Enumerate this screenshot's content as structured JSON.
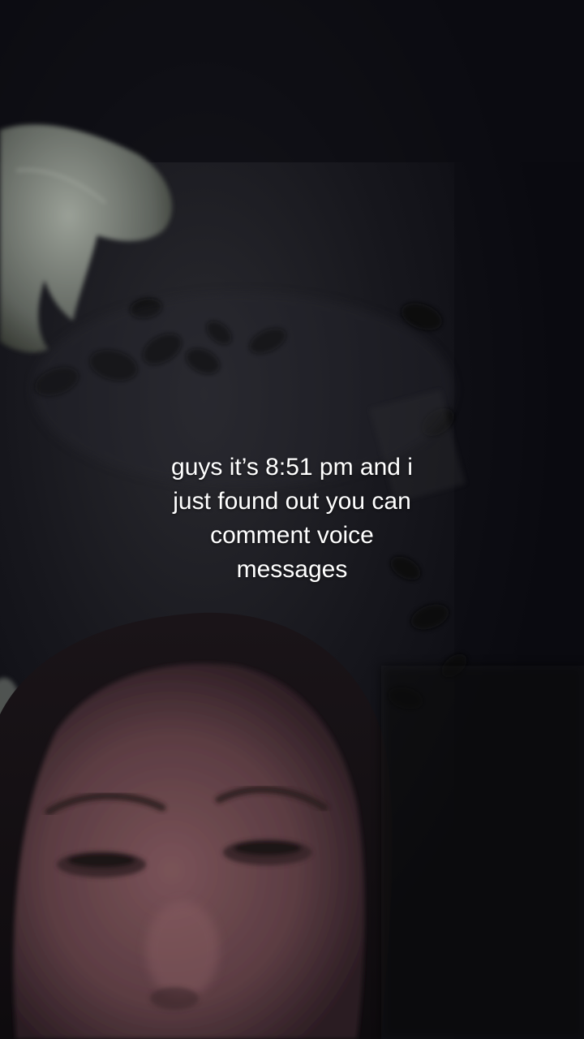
{
  "video": {
    "caption_lines": [
      "guys it’s 8:51 pm and i",
      "just found out you can",
      "comment voice",
      "messages"
    ]
  },
  "colors": {
    "background": "#0d0d13",
    "caption_text": "#ffffff",
    "skin_tone": "#6e4a4e",
    "fabric": "#8a8f88"
  }
}
